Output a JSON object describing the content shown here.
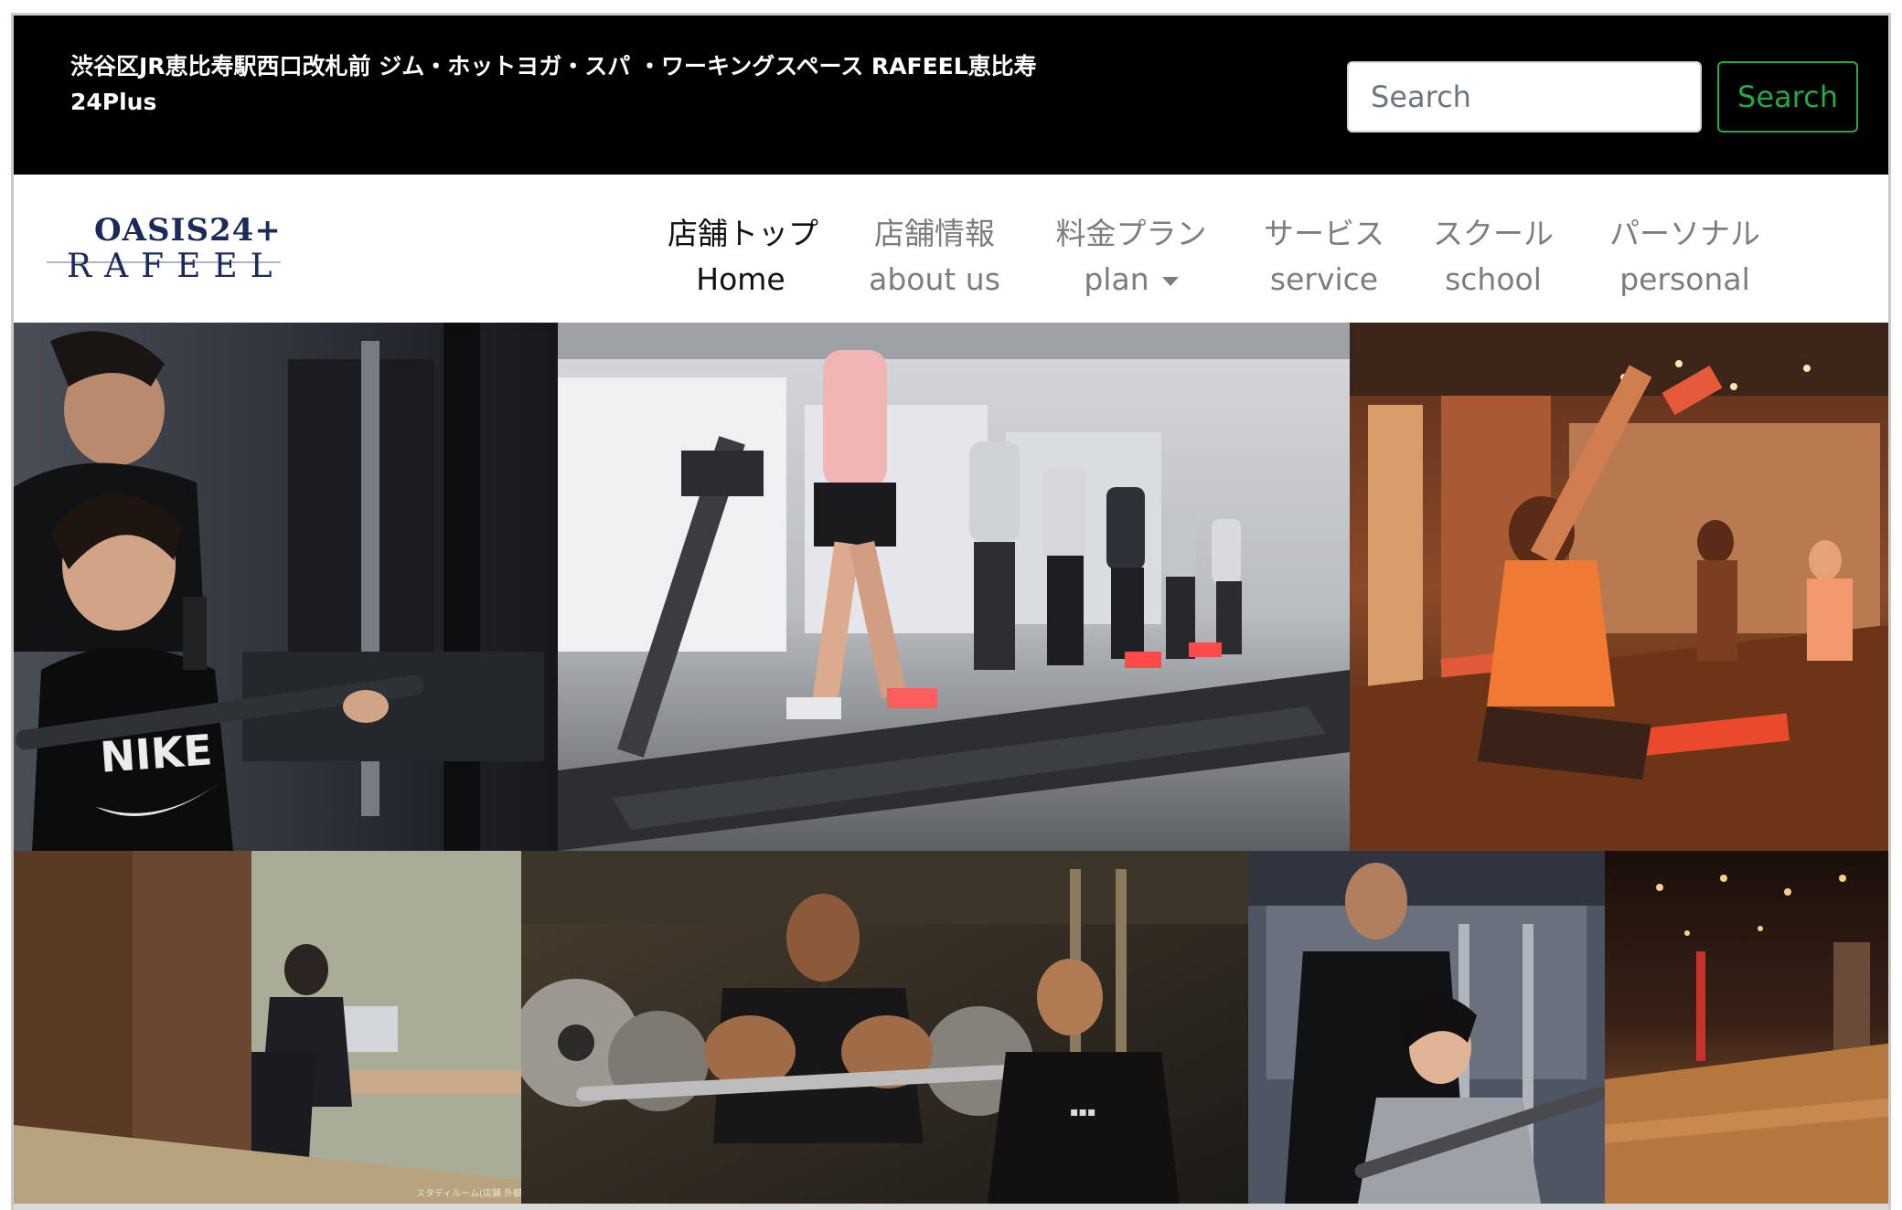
{
  "header": {
    "site_title": "渋谷区JR恵比寿駅西口改札前 ジム・ホットヨガ・スパ ・ワーキングスペース RAFEEL恵比寿24Plus",
    "search_placeholder": "Search",
    "search_button": "Search"
  },
  "brand": {
    "logo_line1": "OASIS24+",
    "logo_line2": "RAFEEL"
  },
  "nav": {
    "items": [
      {
        "ja": "店舗トップ",
        "en": "Home",
        "active": true
      },
      {
        "ja": "店舗情報",
        "en": "about us"
      },
      {
        "ja": "料金プラン",
        "en": "plan",
        "dropdown": true
      },
      {
        "ja": "サービス",
        "en": "service"
      },
      {
        "ja": "スクール",
        "en": "school"
      },
      {
        "ja": "パーソナル",
        "en": "personal"
      }
    ]
  },
  "hero": {
    "photos": [
      {
        "subject": "trainer-assisting-woman-lat-pulldown-photo",
        "shirt_text": "NIKE"
      },
      {
        "subject": "people-running-on-treadmills-photo"
      },
      {
        "subject": "yoga-stretching-class-photo"
      },
      {
        "subject": "coworking-booth-photo",
        "caption": "スタディルーム(店舗 外観例)"
      },
      {
        "subject": "trainer-barbell-curl-photo"
      },
      {
        "subject": "personal-training-photo"
      },
      {
        "subject": "empty-studio-floor-photo"
      }
    ]
  },
  "colors": {
    "topbar_bg": "#000000",
    "search_button_accent": "#28a745",
    "nav_active": "#111111",
    "nav_inactive": "#7d7d7d",
    "logo_navy": "#1b2a5a"
  }
}
